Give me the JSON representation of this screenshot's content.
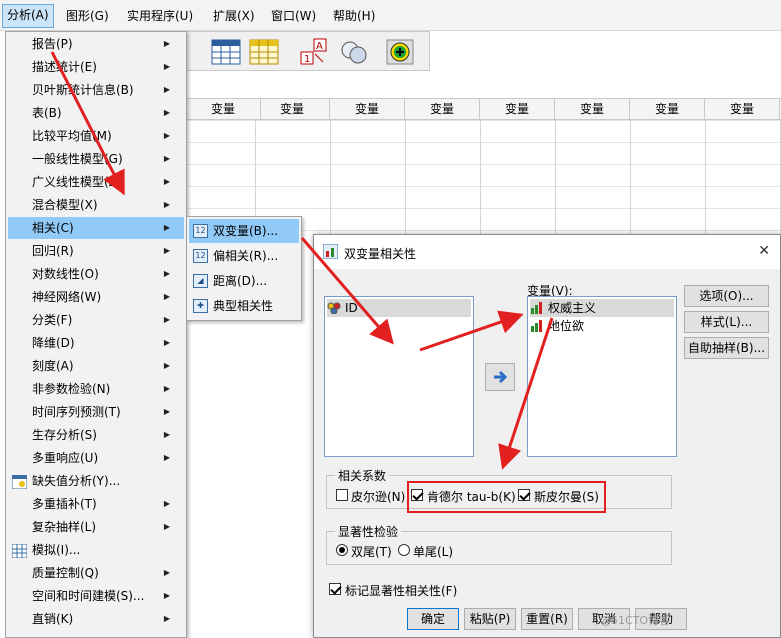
{
  "menubar": {
    "items": [
      {
        "label": "分析(A)"
      },
      {
        "label": "图形(G)"
      },
      {
        "label": "实用程序(U)"
      },
      {
        "label": "扩展(X)"
      },
      {
        "label": "窗口(W)"
      },
      {
        "label": "帮助(H)"
      }
    ]
  },
  "data_view": {
    "column_header": "变量"
  },
  "analyze_menu": {
    "items": [
      {
        "label": "报告(P)"
      },
      {
        "label": "描述统计(E)"
      },
      {
        "label": "贝叶斯统计信息(B)"
      },
      {
        "label": "表(B)"
      },
      {
        "label": "比较平均值(M)"
      },
      {
        "label": "一般线性模型(G)"
      },
      {
        "label": "广义线性模型(Z)"
      },
      {
        "label": "混合模型(X)"
      },
      {
        "label": "相关(C)"
      },
      {
        "label": "回归(R)"
      },
      {
        "label": "对数线性(O)"
      },
      {
        "label": "神经网络(W)"
      },
      {
        "label": "分类(F)"
      },
      {
        "label": "降维(D)"
      },
      {
        "label": "刻度(A)"
      },
      {
        "label": "非参数检验(N)"
      },
      {
        "label": "时间序列预测(T)"
      },
      {
        "label": "生存分析(S)"
      },
      {
        "label": "多重响应(U)"
      },
      {
        "label": "缺失值分析(Y)..."
      },
      {
        "label": "多重插补(T)"
      },
      {
        "label": "复杂抽样(L)"
      },
      {
        "label": "模拟(I)..."
      },
      {
        "label": "质量控制(Q)"
      },
      {
        "label": "空间和时间建模(S)..."
      },
      {
        "label": "直销(K)"
      }
    ]
  },
  "correlate_submenu": {
    "items": [
      {
        "label": "双变量(B)...",
        "icon": "bivariate-icon"
      },
      {
        "label": "偏相关(R)...",
        "icon": "partial-icon"
      },
      {
        "label": "距离(D)...",
        "icon": "distance-icon"
      },
      {
        "label": "典型相关性",
        "icon": "canonical-icon"
      }
    ]
  },
  "dialog": {
    "title": "双变量相关性",
    "close_glyph": "✕",
    "source_list": [
      "ID"
    ],
    "variables_label": "变量(V):",
    "variables": [
      "权威主义",
      "地位欲"
    ],
    "side_buttons": {
      "options": "选项(O)...",
      "style": "样式(L)...",
      "bootstrap": "自助抽样(B)..."
    },
    "correlation_group": {
      "label": "相关系数",
      "pearson": {
        "label": "皮尔逊(N)",
        "checked": false
      },
      "kendall": {
        "label": "肯德尔 tau-b(K)",
        "checked": true
      },
      "spearman": {
        "label": "斯皮尔曼(S)",
        "checked": true
      }
    },
    "significance_group": {
      "label": "显著性检验",
      "two_tailed": {
        "label": "双尾(T)",
        "checked": true
      },
      "one_tailed": {
        "label": "单尾(L)",
        "checked": false
      }
    },
    "flag_significant": {
      "label": "标记显著性相关性(F)",
      "checked": true
    },
    "footer_buttons": {
      "ok": "确定",
      "paste": "粘贴(P)",
      "reset": "重置(R)",
      "cancel": "取消",
      "help": "帮助"
    }
  },
  "watermark": "@51CTO博客",
  "colors": {
    "highlight": "#91c9f7",
    "annotation_arrow": "#e32020"
  }
}
